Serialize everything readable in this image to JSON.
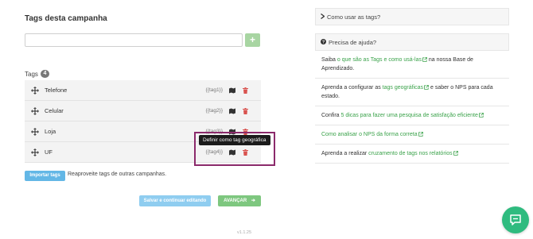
{
  "campaign_tags": {
    "title": "Tags desta campanha",
    "input_value": "",
    "input_placeholder": "",
    "add_label": "+",
    "tags_label": "Tags",
    "tag_count": "4",
    "tags": [
      {
        "name": "Telefone",
        "code": "{{tag1}}"
      },
      {
        "name": "Celular",
        "code": "{{tag2}}"
      },
      {
        "name": "Loja",
        "code": "{{tag3}}"
      },
      {
        "name": "UF",
        "code": "{{tag4}}"
      }
    ],
    "tooltip": "Definir como tag geográfica",
    "import_label": "Importar tags",
    "import_text": "Reaproveite tags de outras campanhas.",
    "save_label": "Salvar e continuar editando",
    "advance_label": "AVANÇAR",
    "advance_arrow": "➔",
    "version": "v1.1.25"
  },
  "help": {
    "how_to_use": "Como usar as tags?",
    "need_help": "Precisa de ajuda?",
    "items": [
      {
        "before": "Saiba ",
        "link": "o que são as Tags e como usá-las",
        "after": " na nossa Base de Aprendizado."
      },
      {
        "before": "Aprenda a configurar as ",
        "link": "tags geográficas",
        "after": " e saber o NPS para cada estado."
      },
      {
        "before": "Confira ",
        "link": "5 dicas para fazer uma pesquisa de satisfação eficiente",
        "after": ""
      },
      {
        "before": "",
        "link": "Como analisar o NPS da forma correta",
        "after": ""
      },
      {
        "before": "Aprenda a realizar ",
        "link": "cruzamento de tags nos relatórios",
        "after": ""
      }
    ]
  },
  "colors": {
    "accent_green": "#3aa24a",
    "chat_green": "#2fbb7f",
    "highlight": "#8b2a6b",
    "delete_red": "#d9534f"
  },
  "icons": {
    "move": "move-icon",
    "map": "map-icon",
    "trash": "trash-icon",
    "chevron": "chevron-right-icon",
    "question": "question-circle-icon",
    "external": "external-link-icon",
    "chat": "chat-icon"
  }
}
